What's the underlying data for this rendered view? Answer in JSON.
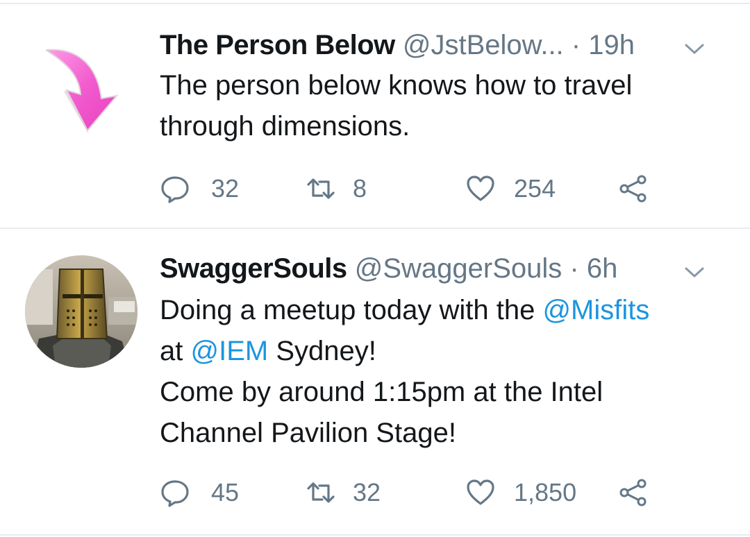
{
  "colors": {
    "text": "#14171a",
    "secondary": "#657786",
    "link": "#1b95e0",
    "divider": "#e6ecf0",
    "arrow_pink": "#f25ccf"
  },
  "tweets": [
    {
      "avatar_icon": "pink-down-arrow",
      "display_name": "The Person Below",
      "handle": "@JstBelow...",
      "separator": "·",
      "time": "19h",
      "lines": [
        "The person below knows how to travel",
        "through dimensions."
      ],
      "reply_count": "32",
      "retweet_count": "8",
      "like_count": "254"
    },
    {
      "avatar_icon": "knight-helmet-photo",
      "display_name": "SwaggerSouls",
      "handle": "@SwaggerSouls",
      "separator": "·",
      "time": "6h",
      "line1_before": "Doing a meetup today with the ",
      "line1_mention": "@Misfits",
      "line2_before": "at ",
      "line2_mention": "@IEM",
      "line2_after": " Sydney!",
      "line3": "Come by around 1:15pm at the Intel",
      "line4": "Channel Pavilion Stage!",
      "reply_count": "45",
      "retweet_count": "32",
      "like_count": "1,850"
    }
  ]
}
